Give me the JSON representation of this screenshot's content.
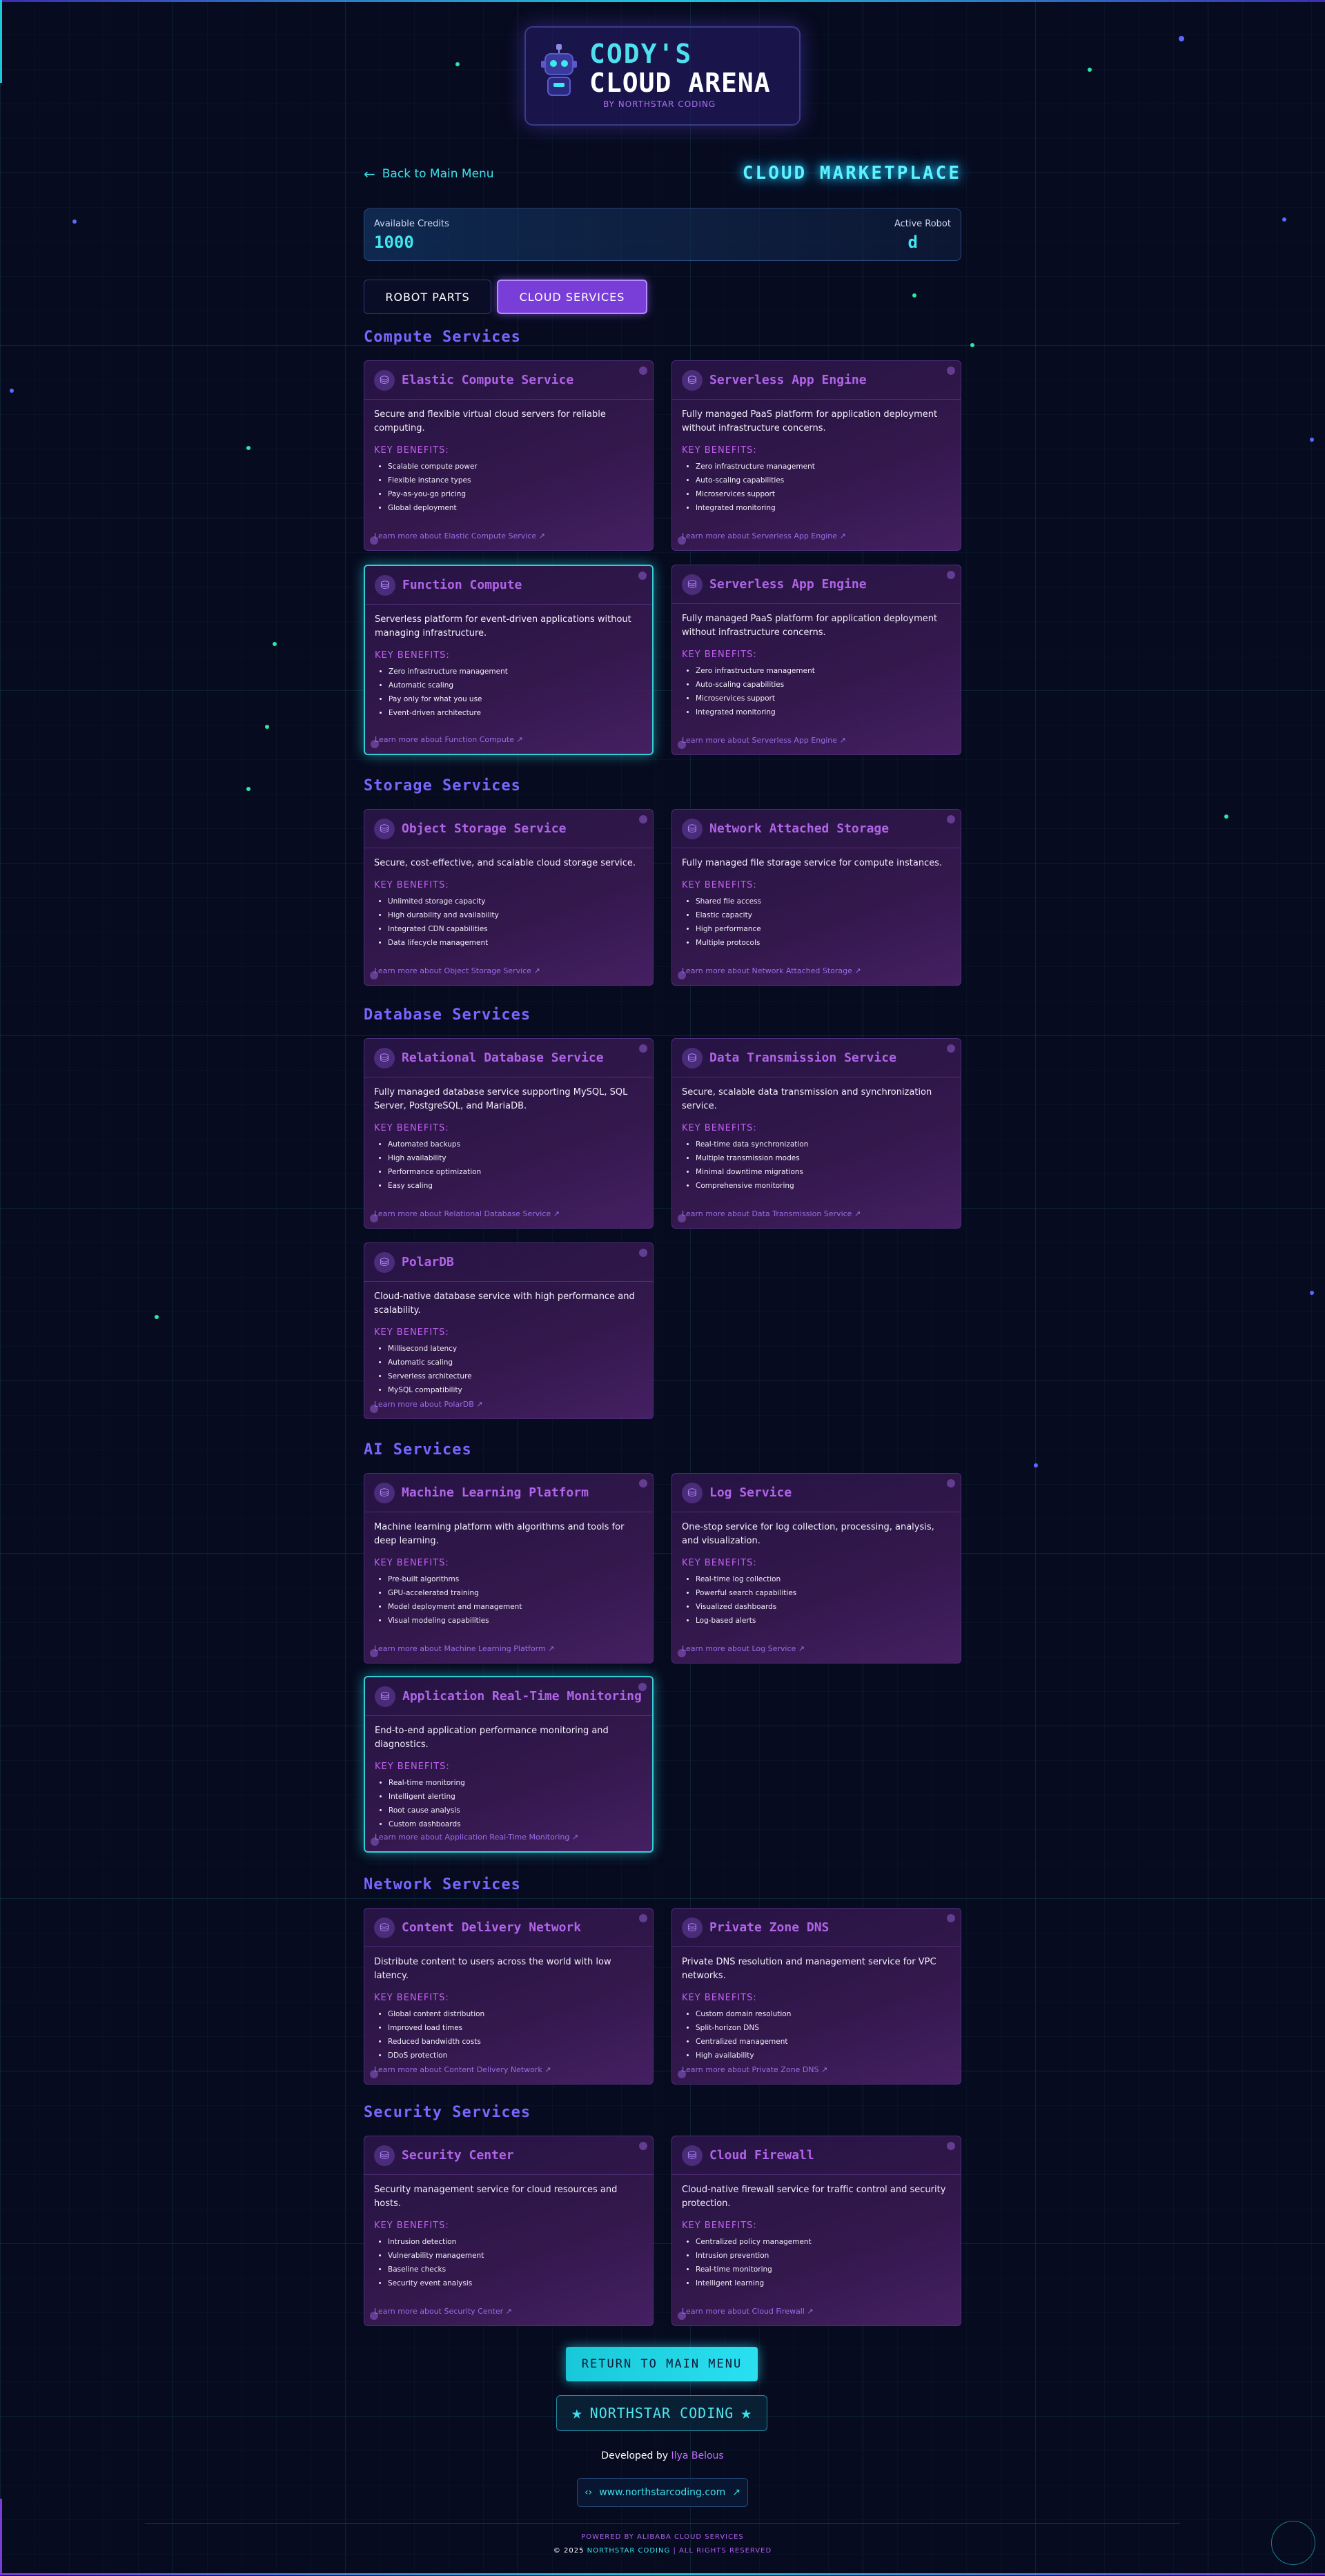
{
  "header": {
    "logo_line1": "CODY'S",
    "logo_line2": "CLOUD ARENA",
    "logo_sub": "BY NORTHSTAR CODING"
  },
  "nav": {
    "back_label": "Back to Main Menu",
    "market_title": "CLOUD MARKETPLACE"
  },
  "credits": {
    "credits_label": "Available Credits",
    "credits_value": "1000",
    "robot_label": "Active Robot",
    "robot_value": "d"
  },
  "tabs": [
    {
      "label": "ROBOT PARTS",
      "active": false
    },
    {
      "label": "CLOUD SERVICES",
      "active": true
    }
  ],
  "sections": {
    "compute": "Compute Services",
    "storage": "Storage Services",
    "database": "Database Services",
    "ai": "AI Services",
    "network": "Network Services",
    "security": "Security Services"
  },
  "benefits_label": "KEY BENEFITS:",
  "cards": {
    "c1": {
      "title": "Elastic Compute Service",
      "desc": "Secure and flexible virtual cloud servers for reliable computing.",
      "benefits": [
        "Scalable compute power",
        "Flexible instance types",
        "Pay-as-you-go pricing",
        "Global deployment"
      ],
      "link": "Learn more about Elastic Compute Service"
    },
    "c2": {
      "title": "Serverless App Engine",
      "desc": "Fully managed PaaS platform for application deployment without infrastructure concerns.",
      "benefits": [
        "Zero infrastructure management",
        "Auto-scaling capabilities",
        "Microservices support",
        "Integrated monitoring"
      ],
      "link": "Learn more about Serverless App Engine"
    },
    "c3": {
      "title": "Function Compute",
      "desc": "Serverless platform for event-driven applications without managing infrastructure.",
      "benefits": [
        "Zero infrastructure management",
        "Automatic scaling",
        "Pay only for what you use",
        "Event-driven architecture"
      ],
      "link": "Learn more about Function Compute"
    },
    "c4": {
      "title": "Serverless App Engine",
      "desc": "Fully managed PaaS platform for application deployment without infrastructure concerns.",
      "benefits": [
        "Zero infrastructure management",
        "Auto-scaling capabilities",
        "Microservices support",
        "Integrated monitoring"
      ],
      "link": "Learn more about Serverless App Engine"
    },
    "s1": {
      "title": "Object Storage Service",
      "desc": "Secure, cost-effective, and scalable cloud storage service.",
      "benefits": [
        "Unlimited storage capacity",
        "High durability and availability",
        "Integrated CDN capabilities",
        "Data lifecycle management"
      ],
      "link": "Learn more about Object Storage Service"
    },
    "s2": {
      "title": "Network Attached Storage",
      "desc": "Fully managed file storage service for compute instances.",
      "benefits": [
        "Shared file access",
        "Elastic capacity",
        "High performance",
        "Multiple protocols"
      ],
      "link": "Learn more about Network Attached Storage"
    },
    "d1": {
      "title": "Relational Database Service",
      "desc": "Fully managed database service supporting MySQL, SQL Server, PostgreSQL, and MariaDB.",
      "benefits": [
        "Automated backups",
        "High availability",
        "Performance optimization",
        "Easy scaling"
      ],
      "link": "Learn more about Relational Database Service"
    },
    "d2": {
      "title": "Data Transmission Service",
      "desc": "Secure, scalable data transmission and synchronization service.",
      "benefits": [
        "Real-time data synchronization",
        "Multiple transmission modes",
        "Minimal downtime migrations",
        "Comprehensive monitoring"
      ],
      "link": "Learn more about Data Transmission Service"
    },
    "d3": {
      "title": "PolarDB",
      "desc": "Cloud-native database service with high performance and scalability.",
      "benefits": [
        "Millisecond latency",
        "Automatic scaling",
        "Serverless architecture",
        "MySQL compatibility"
      ],
      "link": "Learn more about PolarDB"
    },
    "a1": {
      "title": "Machine Learning Platform",
      "desc": "Machine learning platform with algorithms and tools for deep learning.",
      "benefits": [
        "Pre-built algorithms",
        "GPU-accelerated training",
        "Model deployment and management",
        "Visual modeling capabilities"
      ],
      "link": "Learn more about Machine Learning Platform"
    },
    "a2": {
      "title": "Log Service",
      "desc": "One-stop service for log collection, processing, analysis, and visualization.",
      "benefits": [
        "Real-time log collection",
        "Powerful search capabilities",
        "Visualized dashboards",
        "Log-based alerts"
      ],
      "link": "Learn more about Log Service"
    },
    "a3": {
      "title": "Application Real-Time Monitoring",
      "desc": "End-to-end application performance monitoring and diagnostics.",
      "benefits": [
        "Real-time monitoring",
        "Intelligent alerting",
        "Root cause analysis",
        "Custom dashboards"
      ],
      "link": "Learn more about Application Real-Time Monitoring"
    },
    "n1": {
      "title": "Content Delivery Network",
      "desc": "Distribute content to users across the world with low latency.",
      "benefits": [
        "Global content distribution",
        "Improved load times",
        "Reduced bandwidth costs",
        "DDoS protection"
      ],
      "link": "Learn more about Content Delivery Network"
    },
    "n2": {
      "title": "Private Zone DNS",
      "desc": "Private DNS resolution and management service for VPC networks.",
      "benefits": [
        "Custom domain resolution",
        "Split-horizon DNS",
        "Centralized management",
        "High availability"
      ],
      "link": "Learn more about Private Zone DNS"
    },
    "x1": {
      "title": "Security Center",
      "desc": "Security management service for cloud resources and hosts.",
      "benefits": [
        "Intrusion detection",
        "Vulnerability management",
        "Baseline checks",
        "Security event analysis"
      ],
      "link": "Learn more about Security Center"
    },
    "x2": {
      "title": "Cloud Firewall",
      "desc": "Cloud-native firewall service for traffic control and security protection.",
      "benefits": [
        "Centralized policy management",
        "Intrusion prevention",
        "Real-time monitoring",
        "Intelligent learning"
      ],
      "link": "Learn more about Cloud Firewall"
    }
  },
  "footer": {
    "return_label": "RETURN TO MAIN MENU",
    "northstar_label": "NORTHSTAR CODING",
    "developed_by": "Developed by",
    "developer": "Ilya Belous",
    "site": "www.northstarcoding.com",
    "powered": "POWERED BY ALIBABA CLOUD SERVICES",
    "copy_prefix": "© 2025",
    "copy_brand": "NORTHSTAR CODING",
    "copy_suffix": "| ALL RIGHTS RESERVED"
  },
  "colors": {
    "background": "#070b1f",
    "accent_cyan": "#3ee0e8",
    "accent_purple": "#7a3ed8",
    "card_title": "#b064e8"
  }
}
